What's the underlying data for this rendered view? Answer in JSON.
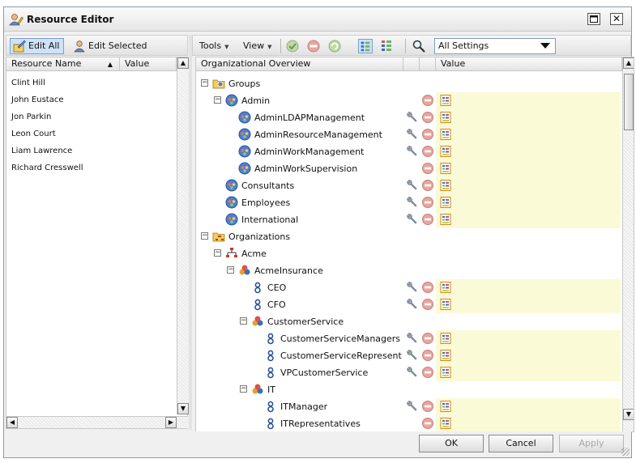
{
  "window": {
    "title": "Resource Editor",
    "icon": "user-edit-icon"
  },
  "left_panel": {
    "toolbar": {
      "edit_all": "Edit All",
      "edit_selected": "Edit Selected"
    },
    "columns": [
      "Resource Name",
      "Value"
    ],
    "resources": [
      "Clint Hill",
      "John Eustace",
      "Jon Parkin",
      "Leon Court",
      "Liam Lawrence",
      "Richard Cresswell"
    ]
  },
  "right_panel": {
    "toolbar": {
      "tools": "Tools",
      "view": "View",
      "settings_value": "All Settings"
    },
    "columns": [
      "Organizational Overview",
      "Value"
    ],
    "tree": [
      {
        "label": "Groups",
        "level": 0,
        "icon": "folder-group-icon",
        "expandable": true,
        "wrench": false,
        "remove": false,
        "value_cell": false
      },
      {
        "label": "Admin",
        "level": 1,
        "icon": "group-icon",
        "expandable": true,
        "wrench": false,
        "remove": true,
        "value_cell": true
      },
      {
        "label": "AdminLDAPManagement",
        "level": 2,
        "icon": "group-icon",
        "expandable": false,
        "wrench": true,
        "remove": true,
        "value_cell": true
      },
      {
        "label": "AdminResourceManagement",
        "level": 2,
        "icon": "group-icon",
        "expandable": false,
        "wrench": true,
        "remove": true,
        "value_cell": true
      },
      {
        "label": "AdminWorkManagement",
        "level": 2,
        "icon": "group-icon",
        "expandable": false,
        "wrench": true,
        "remove": true,
        "value_cell": true
      },
      {
        "label": "AdminWorkSupervision",
        "level": 2,
        "icon": "group-icon",
        "expandable": false,
        "wrench": false,
        "remove": true,
        "value_cell": true
      },
      {
        "label": "Consultants",
        "level": 1,
        "icon": "group-icon",
        "expandable": false,
        "wrench": true,
        "remove": true,
        "value_cell": true
      },
      {
        "label": "Employees",
        "level": 1,
        "icon": "group-icon",
        "expandable": false,
        "wrench": true,
        "remove": true,
        "value_cell": true
      },
      {
        "label": "International",
        "level": 1,
        "icon": "group-icon",
        "expandable": false,
        "wrench": true,
        "remove": true,
        "value_cell": true
      },
      {
        "label": "Organizations",
        "level": 0,
        "icon": "folder-org-icon",
        "expandable": true,
        "wrench": false,
        "remove": false,
        "value_cell": false
      },
      {
        "label": "Acme",
        "level": 1,
        "icon": "org-chart-icon",
        "expandable": true,
        "wrench": false,
        "remove": false,
        "value_cell": false
      },
      {
        "label": "AcmeInsurance",
        "level": 2,
        "icon": "org-unit-icon",
        "expandable": true,
        "wrench": false,
        "remove": false,
        "value_cell": false
      },
      {
        "label": "CEO",
        "level": 3,
        "icon": "position-icon",
        "expandable": false,
        "wrench": true,
        "remove": true,
        "value_cell": true
      },
      {
        "label": "CFO",
        "level": 3,
        "icon": "position-icon",
        "expandable": false,
        "wrench": true,
        "remove": true,
        "value_cell": true
      },
      {
        "label": "CustomerService",
        "level": 3,
        "icon": "org-unit-icon",
        "expandable": true,
        "wrench": false,
        "remove": false,
        "value_cell": false
      },
      {
        "label": "CustomerServiceManagers",
        "level": 4,
        "icon": "position-icon",
        "expandable": false,
        "wrench": true,
        "remove": true,
        "value_cell": true
      },
      {
        "label": "CustomerServiceRepresent",
        "level": 4,
        "icon": "position-icon",
        "expandable": false,
        "wrench": true,
        "remove": true,
        "value_cell": true
      },
      {
        "label": "VPCustomerService",
        "level": 4,
        "icon": "position-icon",
        "expandable": false,
        "wrench": true,
        "remove": true,
        "value_cell": true
      },
      {
        "label": "IT",
        "level": 3,
        "icon": "org-unit-icon",
        "expandable": true,
        "wrench": false,
        "remove": false,
        "value_cell": false
      },
      {
        "label": "ITManager",
        "level": 4,
        "icon": "position-icon",
        "expandable": false,
        "wrench": true,
        "remove": true,
        "value_cell": true
      },
      {
        "label": "ITRepresentatives",
        "level": 4,
        "icon": "position-icon",
        "expandable": false,
        "wrench": false,
        "remove": true,
        "value_cell": true
      }
    ]
  },
  "footer": {
    "ok": "OK",
    "cancel": "Cancel",
    "apply": "Apply"
  },
  "colors": {
    "value_cell": "#fbfad7",
    "accent": "#3b6fb6",
    "selected_bg": "#cfe2f7"
  }
}
